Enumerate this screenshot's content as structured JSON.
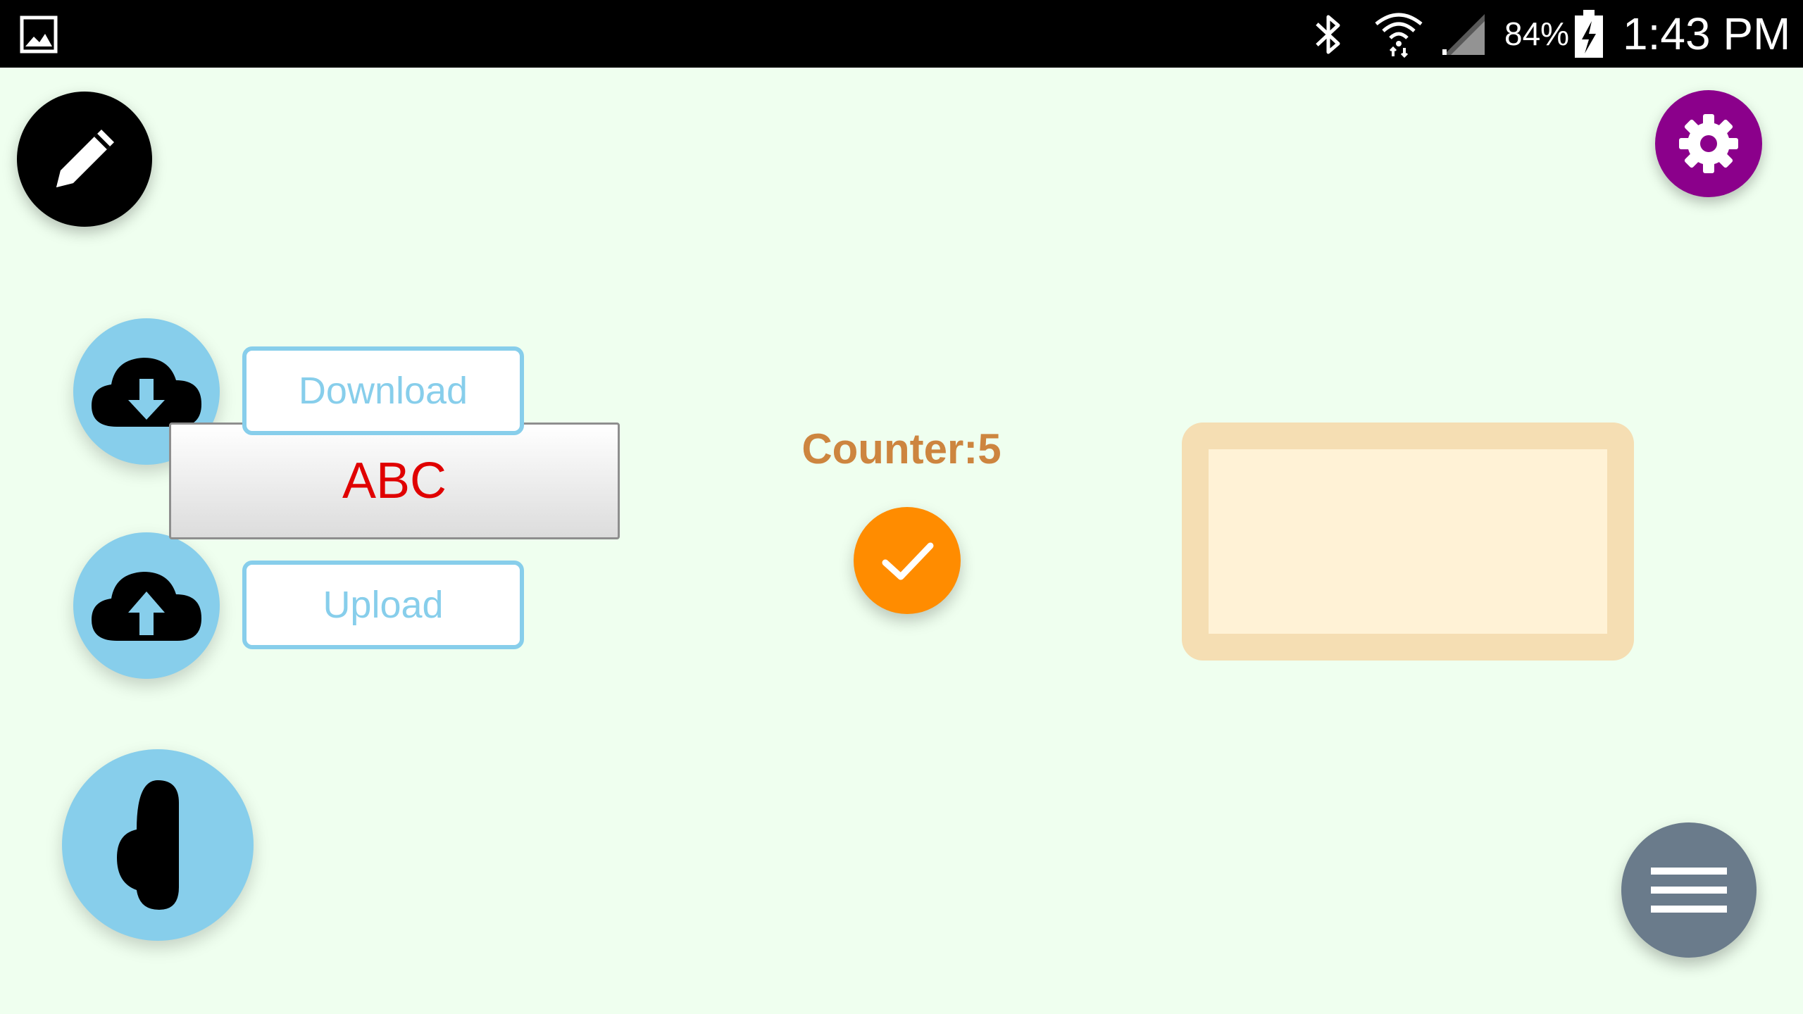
{
  "status_bar": {
    "battery_percent": "84%",
    "time": "1:43 PM",
    "icons": [
      "gallery-icon",
      "bluetooth-icon",
      "wifi-icon",
      "signal-icon",
      "battery-charging-icon"
    ]
  },
  "fabs": {
    "edit": {
      "icon": "pencil-icon",
      "color": "#000000"
    },
    "settings": {
      "icon": "gear-icon",
      "color": "#8b008b"
    },
    "download": {
      "icon": "cloud-download-icon",
      "color": "#87ceeb"
    },
    "upload": {
      "icon": "cloud-upload-icon",
      "color": "#87ceeb"
    },
    "partial": {
      "icon": "cloud-partial-icon",
      "color": "#87ceeb"
    },
    "confirm": {
      "icon": "check-icon",
      "color": "#ff8c00"
    },
    "menu": {
      "icon": "hamburger-menu-icon",
      "color": "#6a7b8b"
    }
  },
  "buttons": {
    "download_label": "Download",
    "upload_label": "Upload",
    "abc_label": "ABC"
  },
  "counter": {
    "text": "Counter:5"
  },
  "colors": {
    "background": "#efffef",
    "accent_blue": "#87ceeb",
    "abc_text": "#e00000",
    "counter_text": "#cd853f",
    "panel_border": "#f5deb3",
    "panel_fill": "#fff2d6"
  }
}
